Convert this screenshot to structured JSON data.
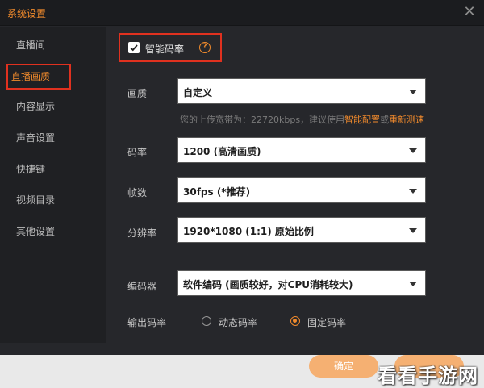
{
  "window": {
    "title": "系统设置"
  },
  "sidebar": {
    "items": [
      {
        "label": "直播间"
      },
      {
        "label": "直播画质"
      },
      {
        "label": "内容显示"
      },
      {
        "label": "声音设置"
      },
      {
        "label": "快捷键"
      },
      {
        "label": "视频目录"
      },
      {
        "label": "其他设置"
      }
    ],
    "active_index": 1
  },
  "smart_bitrate": {
    "label": "智能码率",
    "checked": true,
    "help_icon": "question-icon"
  },
  "quality": {
    "label": "画质",
    "value": "自定义",
    "hint_prefix": "您的上传宽带为：22720kbps，建议使用",
    "hint_link1": "智能配置",
    "hint_mid": "或",
    "hint_link2": "重新测速"
  },
  "bitrate": {
    "label": "码率",
    "value": "1200 (高清画质)"
  },
  "fps": {
    "label": "帧数",
    "value": "30fps (*推荐)"
  },
  "resolution": {
    "label": "分辨率",
    "value": "1920*1080 (1:1) 原始比例"
  },
  "encoder": {
    "label": "编码器",
    "value": "软件编码 (画质较好，对CPU消耗较大)"
  },
  "output_bitrate": {
    "label": "输出码率",
    "options": [
      "动态码率",
      "固定码率"
    ],
    "selected": 1
  },
  "buttons": {
    "confirm": "确定",
    "cancel": ""
  },
  "watermark": "看看手游网",
  "colors": {
    "accent": "#f08a2c",
    "highlight_border": "#e0311f",
    "panel": "#26272b"
  }
}
